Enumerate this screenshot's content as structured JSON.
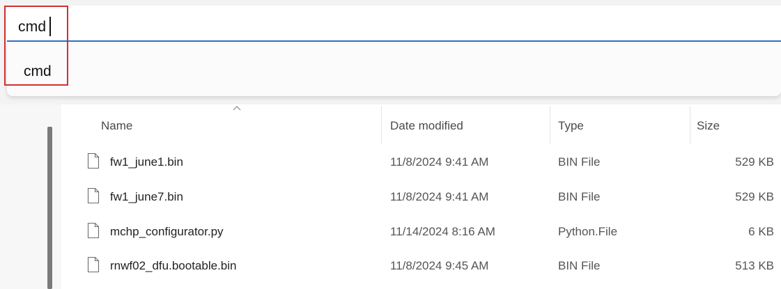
{
  "address_bar": {
    "input_value": "cmd",
    "suggestions": [
      "cmd"
    ]
  },
  "file_list": {
    "columns": {
      "name": "Name",
      "date_modified": "Date modified",
      "type": "Type",
      "size": "Size"
    },
    "rows": [
      {
        "name": "fw1_june1.bin",
        "date": "11/8/2024 9:41 AM",
        "type": "BIN File",
        "size": "529 KB"
      },
      {
        "name": "fw1_june7.bin",
        "date": "11/8/2024 9:41 AM",
        "type": "BIN File",
        "size": "529 KB"
      },
      {
        "name": "mchp_configurator.py",
        "date": "11/14/2024 8:16 AM",
        "type": "Python.File",
        "size": "6 KB"
      },
      {
        "name": "rnwf02_dfu.bootable.bin",
        "date": "11/8/2024 9:45 AM",
        "type": "BIN File",
        "size": "513 KB"
      }
    ]
  },
  "colors": {
    "highlight": "#d32f2f",
    "focus_underline": "#2f6fc7"
  },
  "icons": {
    "file": "file-icon",
    "sort": "sort-up-icon"
  }
}
